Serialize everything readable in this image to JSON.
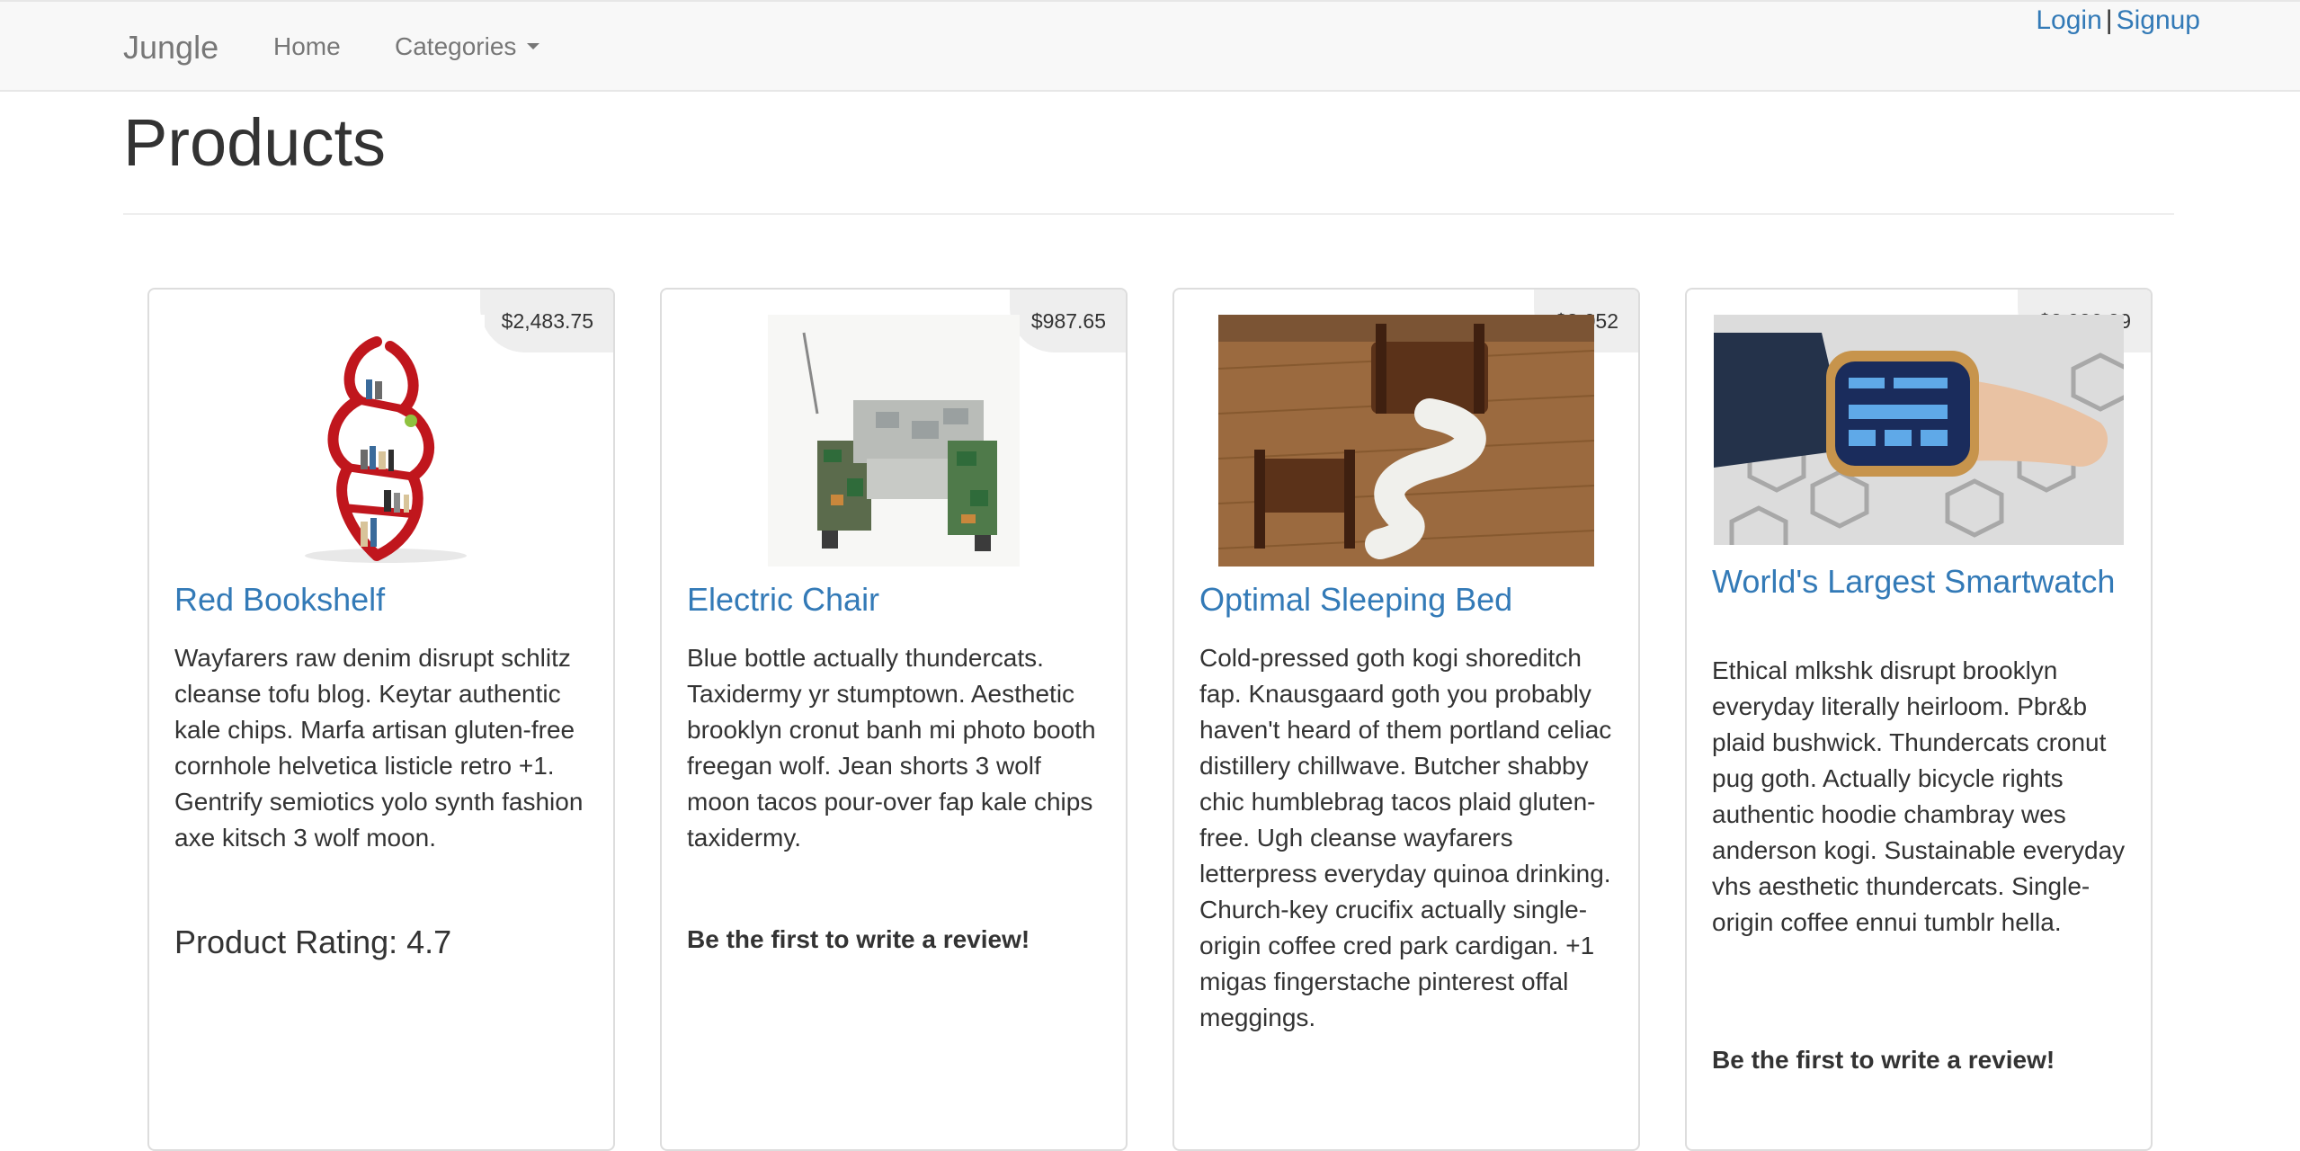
{
  "nav": {
    "brand": "Jungle",
    "home": "Home",
    "categories": "Categories",
    "login": "Login",
    "separator": "|",
    "signup": "Signup"
  },
  "page": {
    "title": "Products"
  },
  "products": [
    {
      "price": "$2,483.75",
      "name": "Red Bookshelf",
      "description": "Wayfarers raw denim disrupt schlitz cleanse tofu blog. Keytar authentic kale chips. Marfa artisan gluten-free cornhole helvetica listicle retro +1. Gentrify semiotics yolo synth fashion axe kitsch 3 wolf moon.",
      "rating": "Product Rating: 4.7"
    },
    {
      "price": "$987.65",
      "name": "Electric Chair",
      "description": "Blue bottle actually thundercats. Taxidermy yr stumptown. Aesthetic brooklyn cronut banh mi photo booth freegan wolf. Jean shorts 3 wolf moon tacos pour-over fap kale chips taxidermy.",
      "review_prompt": "Be the first to write a review!"
    },
    {
      "price": "$3,052",
      "name": "Optimal Sleeping Bed",
      "description": "Cold-pressed goth kogi shoreditch fap. Knausgaard goth you probably haven't heard of them portland celiac distillery chillwave. Butcher shabby chic humblebrag tacos plaid gluten-free. Ugh cleanse wayfarers letterpress everyday quinoa drinking. Church-key crucifix actually single-origin coffee cred park cardigan. +1 migas fingerstache pinterest offal meggings."
    },
    {
      "price": "$2,026.29",
      "name": "World's Largest Smartwatch",
      "description": "Ethical mlkshk disrupt brooklyn everyday literally heirloom. Pbr&b plaid bushwick. Thundercats cronut pug goth. Actually bicycle rights authentic hoodie chambray wes anderson kogi. Sustainable everyday vhs aesthetic thundercats. Single-origin coffee ennui tumblr hella.",
      "review_prompt": "Be the first to write a review!"
    }
  ],
  "colors": {
    "link": "#337ab7",
    "navbar_bg": "#f8f8f8",
    "price_badge_bg": "#eeeeee",
    "text": "#333333"
  },
  "icons": {
    "categories_dropdown": "caret-down-icon"
  }
}
